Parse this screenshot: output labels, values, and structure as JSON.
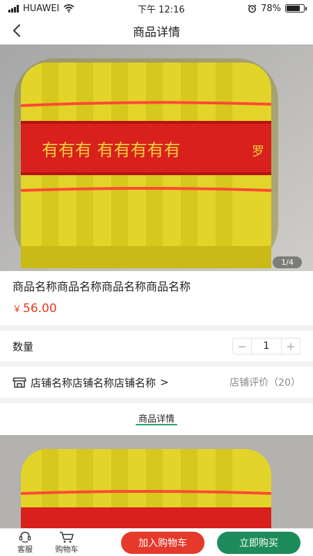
{
  "status_bar": {
    "carrier": "HUAWEI",
    "time": "下午 12:16",
    "battery": "78%",
    "battery_level": 0.78,
    "icons": [
      "signal-icon",
      "wifi-icon",
      "alarm-icon",
      "battery-icon"
    ]
  },
  "nav": {
    "title": "商品详情",
    "back_icon": "back-arrow-icon"
  },
  "gallery": {
    "counter": "1/4",
    "image_subject": "yellow-paper-bundle-with-red-band"
  },
  "product": {
    "name": "商品名称商品名称商品名称商品名称",
    "price_symbol": "￥",
    "price_value": "56.00"
  },
  "quantity": {
    "label": "数量",
    "minus": "−",
    "value": "1",
    "plus": "+"
  },
  "shop": {
    "name": "店铺名称店铺名称店铺名称",
    "arrow": ">",
    "rating_link": "店铺评价（20）",
    "icon": "store-icon"
  },
  "tabs": [
    {
      "label": "商品详情",
      "active": true
    }
  ],
  "bottom_bar": {
    "service_label": "客服",
    "cart_label": "购物车",
    "add_to_cart": "加入购物车",
    "buy_now": "立即购买"
  },
  "colors": {
    "price": "#e53a1f",
    "accent_green": "#2aa36a",
    "buy_green": "#1e8c5a",
    "cart_red": "#e5392b"
  }
}
